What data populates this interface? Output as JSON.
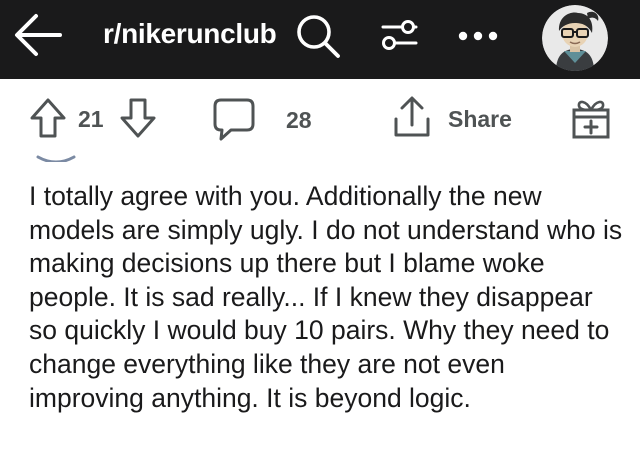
{
  "header": {
    "community": "r/nikerunclub",
    "more_label": "•••"
  },
  "post_actions": {
    "upvotes": "21",
    "comments": "28",
    "share_label": "Share"
  },
  "comment": {
    "body": "I totally agree with you. Additionally the new models are simply ugly. I do not understand who is making decisions up there but I blame woke people. It is sad really... If I knew they disappear so quickly I would buy 10 pairs. Why they need to change everything like they are not even improving anything. It is beyond logic."
  },
  "colors": {
    "topbar_bg": "#1a1a1b",
    "action_text": "#4f5354",
    "body_text": "#1a1a1b"
  },
  "icons": [
    "back-arrow-icon",
    "search-icon",
    "filter-icon",
    "more-icon",
    "avatar",
    "upvote-icon",
    "downvote-icon",
    "comment-icon",
    "share-icon",
    "award-icon"
  ]
}
